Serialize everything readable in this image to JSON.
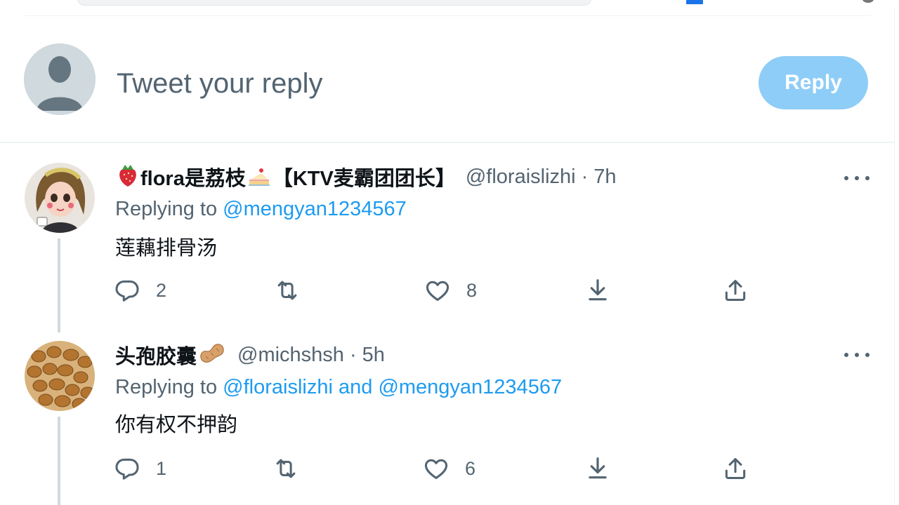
{
  "compose": {
    "placeholder": "Tweet your reply",
    "reply_button": "Reply"
  },
  "tweets": [
    {
      "display_name": "flora是荔枝",
      "display_name_suffix": "【KTV麦霸团团长】",
      "emojis": [
        "strawberry-emoji",
        "cake-emoji"
      ],
      "handle": "@floraislizhi",
      "separator": "·",
      "time": "7h",
      "replying_label": "Replying to",
      "replying_to": [
        "@mengyan1234567"
      ],
      "text": "莲藕排骨汤",
      "reply_count": "2",
      "like_count": "8"
    },
    {
      "display_name": "头孢胶囊",
      "emojis": [
        "peanut-emoji"
      ],
      "handle": "@michshsh",
      "separator": "·",
      "time": "5h",
      "replying_label": "Replying to",
      "replying_to": [
        "@floraislizhi",
        "@mengyan1234567"
      ],
      "replying_joiner": "and",
      "text": "你有权不押韵",
      "reply_count": "1",
      "like_count": "6"
    }
  ],
  "colors": {
    "accent": "#1d9bf0",
    "reply_button_disabled": "#8ecdf7",
    "secondary_text": "#536471",
    "primary_text": "#0f1419",
    "divider": "#eff3f4"
  },
  "icons": [
    "reply-icon",
    "retweet-icon",
    "like-icon",
    "download-icon",
    "share-icon",
    "more-icon"
  ]
}
